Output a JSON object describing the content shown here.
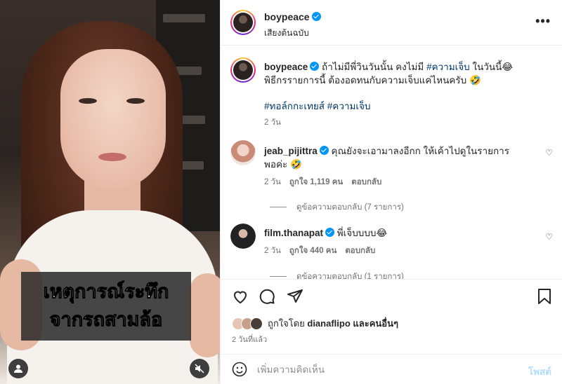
{
  "media": {
    "caption_line1": "เหตุการณ์ระทึก",
    "caption_line2": "จากรถสามล้อ",
    "user_icon": "user-icon",
    "mute_icon": "speaker-muted-icon"
  },
  "header": {
    "username": "boypeace",
    "audio": "เสียงต้นฉบับ",
    "more_icon": "more-horizontal-icon"
  },
  "caption": {
    "username": "boypeace",
    "text_part1": " ถ้าไม่มีพี่วินวันนั้น คงไม่มี ",
    "tag_inline": "#ความเจ็บ",
    "text_part2": " ในวันนี้😂",
    "line2": "พิธีกรรายการนี้ ต้องอดทนกับความเจ็บแค่ไหนครับ 🤣",
    "hashtags": "#ทอล์กกะเทยส์ #ความเจ็บ",
    "time": "2 วัน"
  },
  "comments": [
    {
      "username": "jeab_pijittra",
      "text": " คุณยังจะเอามาลงอีกก ให้เค้าไปดูในรายการพอค่ะ 🤣",
      "time": "2 วัน",
      "likes": "ถูกใจ 1,119 คน",
      "reply": "ตอบกลับ",
      "view_replies": "ดูข้อความตอบกลับ (7 รายการ)"
    },
    {
      "username": "film.thanapat",
      "text": " พี่เจ็บบบบ😂",
      "time": "2 วัน",
      "likes": "ถูกใจ 440 คน",
      "reply": "ตอบกลับ",
      "view_replies": "ดูข้อความตอบกลับ (1 รายการ)"
    }
  ],
  "actions": {
    "like_icon": "heart-icon",
    "comment_icon": "comment-icon",
    "share_icon": "send-icon",
    "save_icon": "bookmark-icon"
  },
  "likes_summary": {
    "prefix": "ถูกใจโดย ",
    "user": "dianaflipo",
    "suffix": " และคนอื่นๆ"
  },
  "posted_time": "2 วันที่แล้ว",
  "composer": {
    "emoji_icon": "emoji-icon",
    "placeholder": "เพิ่มความคิดเห็น",
    "post_label": "โพสต์"
  },
  "colors": {
    "link": "#00376b",
    "verified": "#0095f6",
    "post_disabled": "#b2dffc",
    "muted_text": "#737373"
  }
}
